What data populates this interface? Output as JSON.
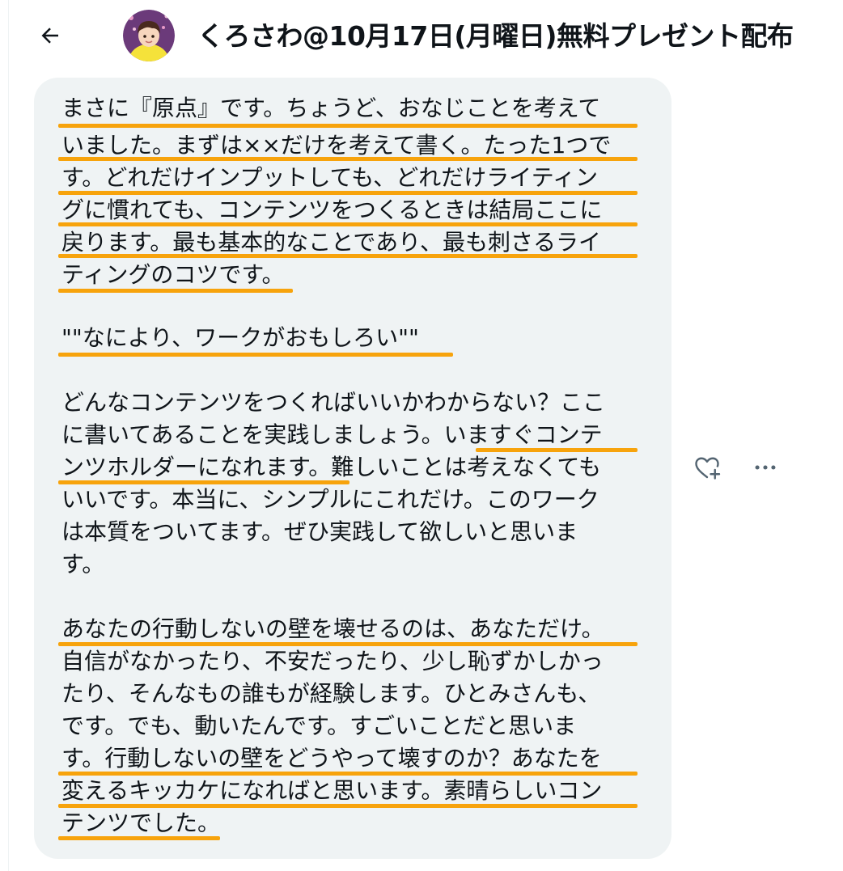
{
  "header": {
    "title": "くろさわ@10月17日(月曜日)無料プレゼント配布",
    "back_icon": "arrow-left-icon",
    "avatar_icon": "user-avatar"
  },
  "message": {
    "lines": [
      "まさに『原点』です。ちょうど、おなじことを考えて",
      "いました。まずは××だけを考えて書く。たった1つで",
      "す。どれだけインプットしても、どれだけライティン",
      "グに慣れても、コンテンツをつくるときは結局ここに",
      "戻ります。最も基本的なことであり、最も刺さるライ",
      "ティングのコツです。",
      "\"\"なにより、ワークがおもしろい\"\"",
      "どんなコンテンツをつくればいいかわからない？ここ",
      "に書いてあることを実践しましょう。いますぐコンテ",
      "ンツホルダーになれます。難しいことは考えなくても",
      "いいです。本当に、シンプルにこれだけ。このワーク",
      "は本質をついてます。ぜひ実践して欲しいと思いま",
      "す。",
      "あなたの行動しないの壁を壊せるのは、あなただけ。",
      "自信がなかったり、不安だったり、少し恥ずかしかっ",
      "たり、そんなもの誰もが経験します。ひとみさんも、",
      "です。でも、動いたんです。すごいことだと思いま",
      "す。行動しないの壁をどうやって壊すのか？あなたを",
      "変えるキッカケになればと思います。素晴らしいコン",
      "テンツでした。"
    ]
  },
  "actions": {
    "like_icon": "heart-plus-icon",
    "more_icon": "more-horizontal-icon"
  },
  "colors": {
    "highlight": "#f7a30c",
    "bubble": "#eff3f4",
    "text": "#0f1419"
  }
}
